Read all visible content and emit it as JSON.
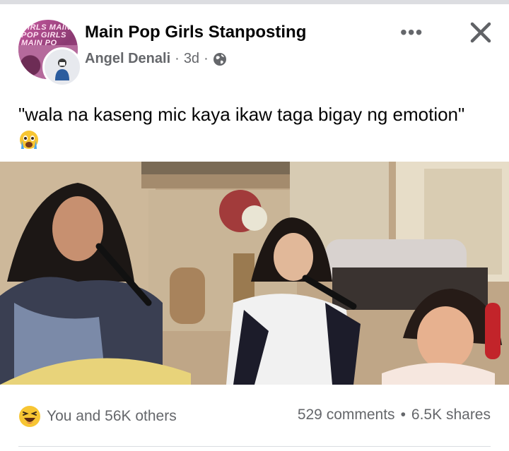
{
  "post": {
    "page_name": "Main Pop Girls Stanposting",
    "avatar_text": "GIRLS MAIN POP GIRLS MAIN PO",
    "author": "Angel Denali",
    "separator": "·",
    "time": "3d",
    "caption": "\"wala na kaseng mic kaya ikaw taga bigay ng emotion\"",
    "caption_emoji": "crying-face",
    "photo_description": "three people singing karaoke"
  },
  "header_actions": {
    "more_label": "•••",
    "close_icon": "close-icon"
  },
  "footer": {
    "reaction_emoji": "laughing-face",
    "reactions_text": "You and 56K others",
    "comments": "529 comments",
    "dot": "•",
    "shares": "6.5K shares"
  },
  "colors": {
    "text_primary": "#050505",
    "text_secondary": "#65676b",
    "divider": "#dadde1",
    "emoji_yellow": "#f7c533"
  }
}
